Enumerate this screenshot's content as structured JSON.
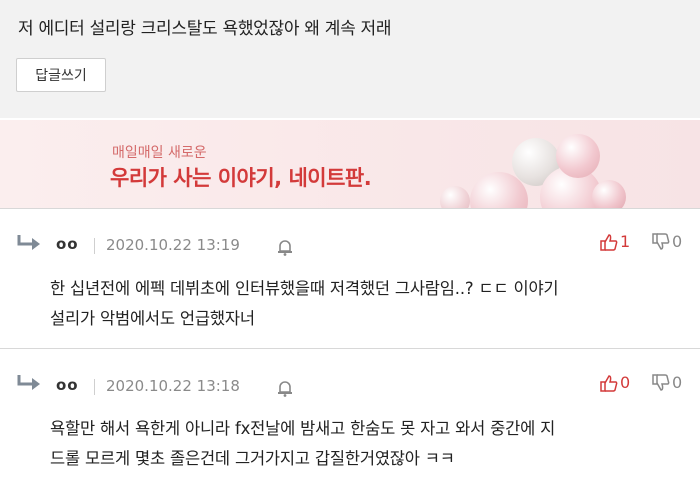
{
  "top_comment": {
    "text": "저 에디터 설리랑 크리스탈도 욕했었잖아 왜 계속 저래",
    "reply_button": "답글쓰기"
  },
  "banner": {
    "subtitle": "매일매일 새로운",
    "title": "우리가 사는 이야기, 네이트판."
  },
  "comments": [
    {
      "nickname": "oo",
      "date": "2020.10.22 13:19",
      "likes": "1",
      "dislikes": "0",
      "line1": "한 십년전에 에펙 데뷔초에 인터뷰했을때 저격했던 그사람임..? ㄷㄷ 이야기",
      "line2": "설리가 악범에서도 언급했자너"
    },
    {
      "nickname": "oo",
      "date": "2020.10.22 13:18",
      "likes": "0",
      "dislikes": "0",
      "line1": "욕할만 해서 욕한게 아니라 fx전날에 밤새고 한숨도 못 자고 와서 중간에 지",
      "line2": "드롤 모르게 몇초 졸은건데 그거가지고 갑질한거였잖아 ㅋㅋ"
    }
  ],
  "colors": {
    "accent": "#d33a3a",
    "banner_bg": "#fbeeee",
    "top_bg": "#f2f2f2"
  }
}
